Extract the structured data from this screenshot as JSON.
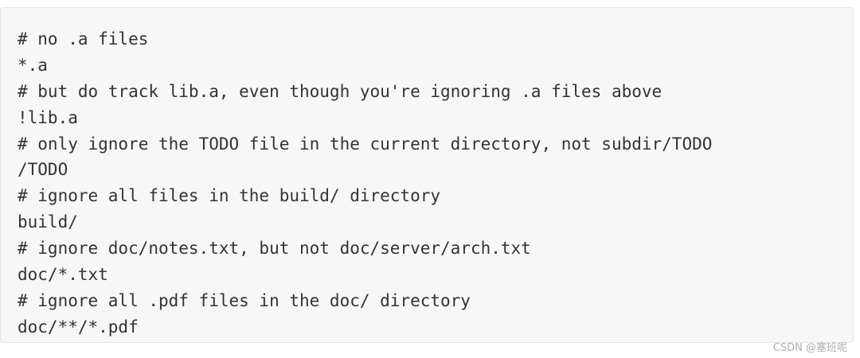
{
  "code_block": {
    "lines": [
      "# no .a files",
      "*.a",
      "# but do track lib.a, even though you're ignoring .a files above",
      "!lib.a",
      "# only ignore the TODO file in the current directory, not subdir/TODO",
      "/TODO",
      "# ignore all files in the build/ directory",
      "build/",
      "# ignore doc/notes.txt, but not doc/server/arch.txt",
      "doc/*.txt",
      "# ignore all .pdf files in the doc/ directory",
      "doc/**/*.pdf"
    ]
  },
  "watermark": {
    "text": "CSDN @塞班呢"
  },
  "colors": {
    "panel_background": "#f7f7f7",
    "code_text": "#333333",
    "watermark_text": "#b0b0b0"
  }
}
